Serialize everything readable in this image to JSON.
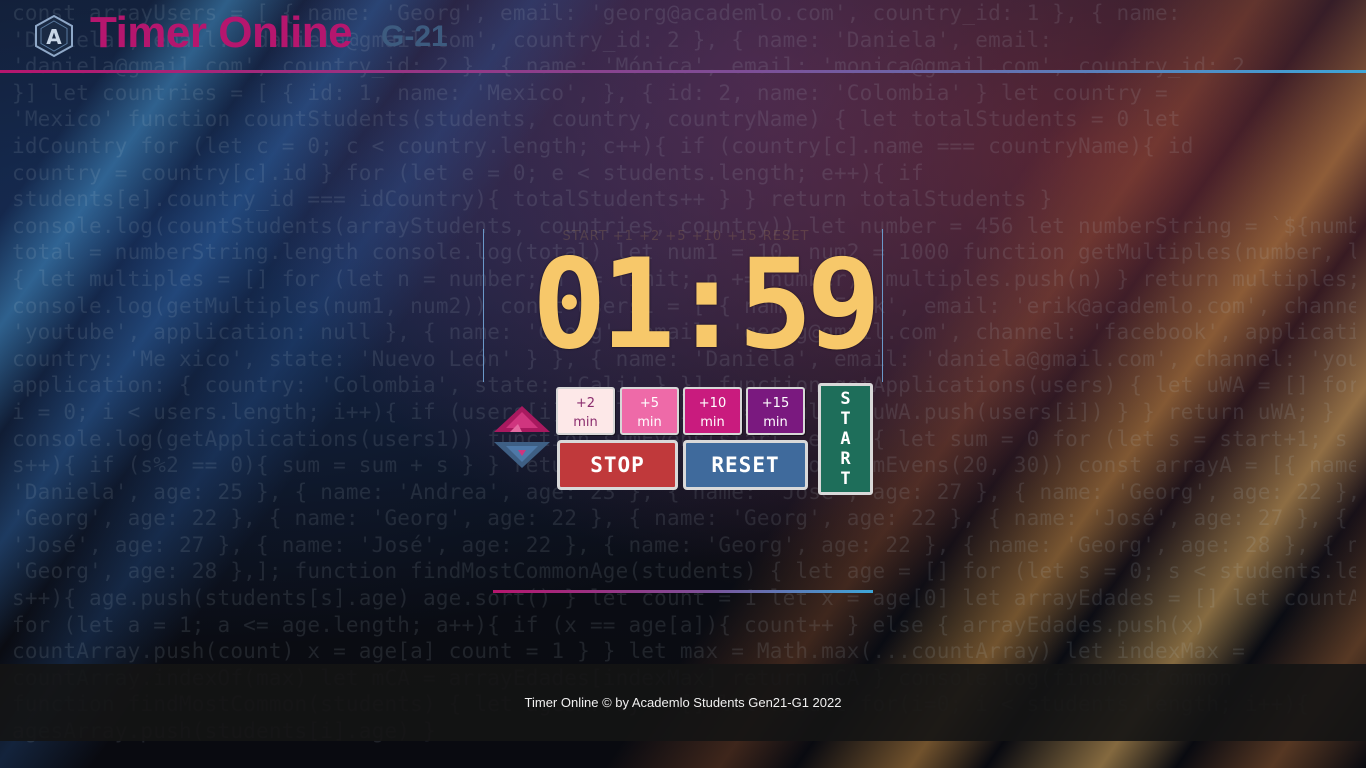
{
  "header": {
    "brand": "Timer Online",
    "subtitle": "G-21",
    "logo_letter": "A"
  },
  "timer": {
    "ghost_controls": "START  +1  +2  +5  +10  +15  RESET",
    "display": "01:59"
  },
  "controls": {
    "add2": {
      "value": "+2",
      "unit": "min"
    },
    "add5": {
      "value": "+5",
      "unit": "min"
    },
    "add10": {
      "value": "+10",
      "unit": "min"
    },
    "add15": {
      "value": "+15",
      "unit": "min"
    },
    "stop_label": "STOP",
    "reset_label": "RESET",
    "start_letters": [
      "S",
      "T",
      "A",
      "R",
      "T"
    ]
  },
  "footer": {
    "text": "Timer Online © by Academlo Students Gen21-G1 2022"
  },
  "colors": {
    "brand": "#b5166e",
    "digits": "#f7c86a",
    "stop": "#c0393b",
    "reset": "#3f6a9c",
    "start": "#1e6e5a"
  },
  "background_code": [
    "const arrayUsers = [ { name: 'Georg', email: 'georg@academlo.com', country_id: 1 }, { name:",
    "'Daniela', email: 'daniela@gmail.com', country_id: 2 }, { name: 'Daniela', email:",
    "'daniela@gmail.com', country_id: 2 }, { name: 'Mónica', email: 'monica@gmail.com', country_id: 2",
    "}] let countries = [ { id: 1, name: 'Mexico', }, { id: 2, name: 'Colombia' } let country =",
    "'Mexico' function countStudents(students, country, countryName) { let totalStudents = 0 let",
    "idCountry for (let c = 0; c < country.length; c++){ if (country[c].name === countryName){ id",
    "country = country[c].id } for (let e = 0; e < students.length; e++){ if",
    "students[e].country_id === idCountry){ totalStudents++ } } return totalStudents }",
    "console.log(countStudents(arrayStudents, countries, country)) let number = 456 let numberString = `${number}` let",
    "total = numberString.length console.log(total) let num1 = 10, num2 = 1000 function getMultiples(number, limit)",
    "{ let multiples = [] for (let n = number; n <= limit; n += number){ multiples.push(n) } return multiples; }",
    "console.log(getMultiples(num1, num2)) const users1 = [ { name: 'Erik', email: 'erik@academlo.com', channel:",
    "'youtube', application: null }, { name: 'Georg', email: 'georg@gmail.com', channel: 'facebook', application: {",
    "country: 'Me xico', state: 'Nuevo León' } }, { name: 'Daniela', email: 'daniela@gmail.com', channel: 'youtube',",
    "application: { country: 'Colombia', state: 'Cali' } }] function getApplications(users) { let uWA = [] for (let",
    "i = 0; i < users.length; i++){ if (users[i].application !== null){ uWA.push(users[i]) } } return uWA; }",
    "console.log(getApplications(users1)) function sumEvens(start, end) { let sum = 0 for (let s = start+1; s < end;",
    "s++){ if (s%2 == 0){ sum = sum + s } } return sum; } console.log(sumEvens(20, 30)) const arrayA = [{ name:",
    "'Daniela', age: 25 }, { name: 'Andrea', age: 23 }, { name: 'José', age: 27 }, { name: 'Georg', age: 22 }, { name:",
    "'Georg', age: 22 }, { name: 'Georg', age: 22 }, { name: 'Georg', age: 22 }, { name: 'José', age: 27 }, { name:",
    "'José', age: 27 }, { name: 'José', age: 22 }, { name: 'Georg', age: 22 }, { name: 'Georg', age: 28 }, { name:",
    "'Georg', age: 28 },]; function findMostCommonAge(students) { let age = [] for (let s = 0; s < students.length;",
    "s++){ age.push(students[s].age) age.sort() } let count = 1 let x = age[0] let arrayEdades = [] let countArray",
    "for (let a = 1; a <= age.length; a++){ if (x == age[a]){ count++ } else { arrayEdades.push(x)",
    "countArray.push(count) x = age[a] count = 1 } } let max = Math.max(...countArray) let indexMax =",
    "countArray.indexOf(max) let mCA = arrayEdades[indexMax] return mCA } console.log(findMostCommon",
    "function findMostCommon(students) { let agesArray = [] let result for(i=0; i < students.length; i++){",
    "agesArray.push(students[i].age) }"
  ]
}
